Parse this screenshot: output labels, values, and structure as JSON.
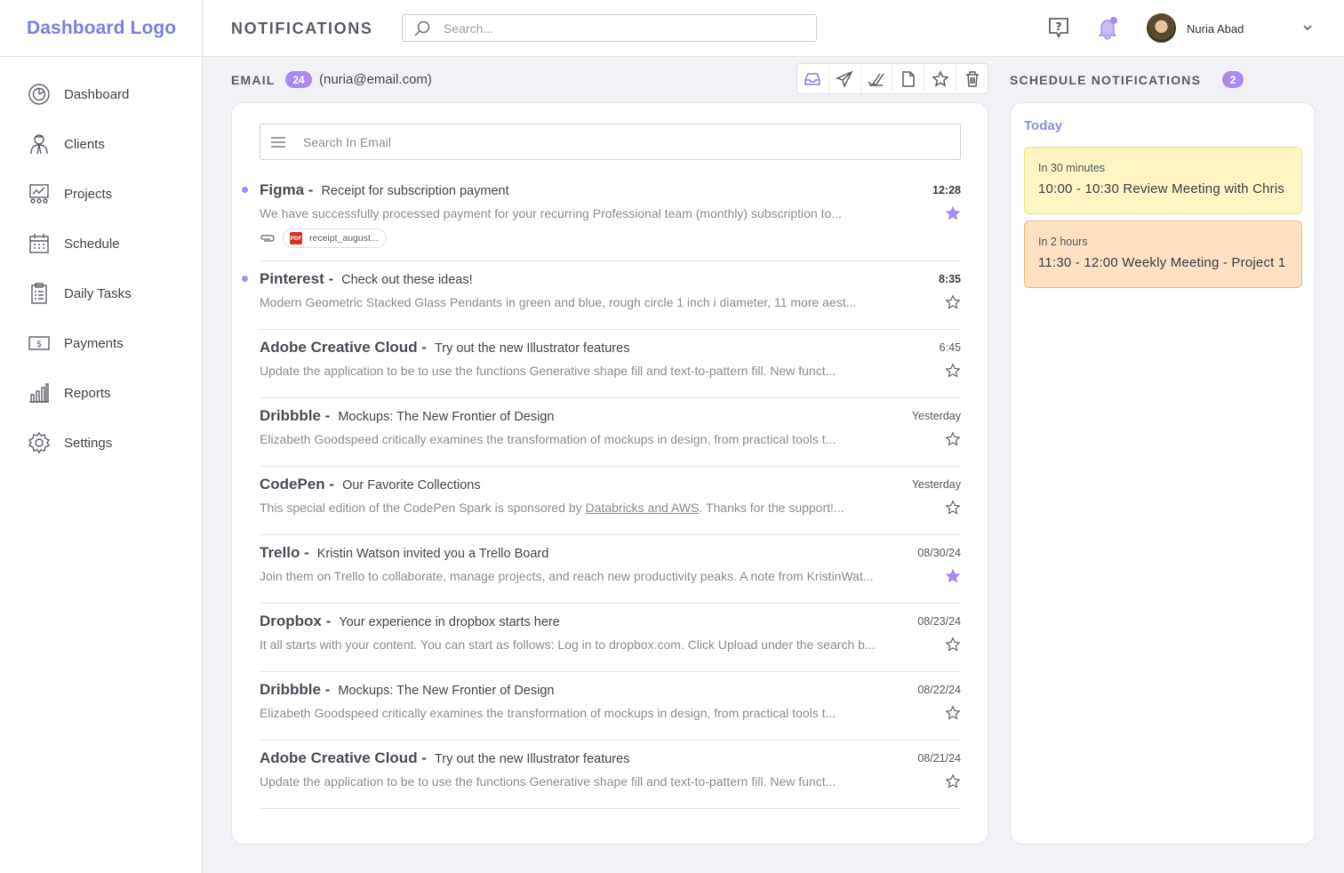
{
  "app": {
    "logo": "Dashboard Logo"
  },
  "sidebar": {
    "items": [
      {
        "label": "Dashboard",
        "icon": "dashboard-icon"
      },
      {
        "label": "Clients",
        "icon": "clients-icon"
      },
      {
        "label": "Projects",
        "icon": "projects-icon"
      },
      {
        "label": "Schedule",
        "icon": "calendar-icon"
      },
      {
        "label": "Daily Tasks",
        "icon": "clipboard-icon"
      },
      {
        "label": "Payments",
        "icon": "dollar-icon"
      },
      {
        "label": "Reports",
        "icon": "bar-chart-icon"
      },
      {
        "label": "Settings",
        "icon": "gear-icon"
      }
    ]
  },
  "header": {
    "title": "NOTIFICATIONS",
    "search_placeholder": "Search...",
    "user_name": "Nuria Abad"
  },
  "email": {
    "label": "EMAIL",
    "count": "24",
    "address": "(nuria@email.com)",
    "toolbar": [
      "inbox-icon",
      "send-icon",
      "read-icon",
      "document-icon",
      "star-icon",
      "trash-icon"
    ],
    "search_placeholder": "Search In Email",
    "messages": [
      {
        "sender": "Figma -",
        "subject": "Receipt for subscription payment",
        "preview": "We have successfully processed payment for your recurring Professional team (monthly) subscription to...",
        "time": "12:28",
        "unread": true,
        "starred": true,
        "attachment": "receipt_august..."
      },
      {
        "sender": "Pinterest -",
        "subject": "Check out these ideas!",
        "preview": "Modern Geometric Stacked Glass Pendants in green and blue, rough circle 1 inch i diameter, 11 more aest...",
        "time": "8:35",
        "unread": true,
        "starred": false
      },
      {
        "sender": "Adobe Creative Cloud -",
        "subject": "Try out the new Illustrator features",
        "preview": "Update the application to be to use the functions Generative shape fill and text-to-pattern fill. New funct...",
        "time": "6:45",
        "unread": false,
        "starred": false
      },
      {
        "sender": "Dribbble -",
        "subject": "Mockups: The New Frontier of Design",
        "preview": "Elizabeth Goodspeed critically examines the transformation of mockups in design, from practical tools t...",
        "time": "Yesterday",
        "unread": false,
        "starred": false
      },
      {
        "sender": "CodePen -",
        "subject": "Our Favorite Collections",
        "preview_before": "This special edition of the CodePen Spark is sponsored by ",
        "preview_link": "Databricks and AWS",
        "preview_after": ". Thanks for the support!...",
        "time": "Yesterday",
        "unread": false,
        "starred": false
      },
      {
        "sender": "Trello -",
        "subject": "Kristin Watson invited you a Trello Board",
        "preview": "Join them on Trello to collaborate, manage projects, and reach new productivity peaks. A note from KristinWat...",
        "time": "08/30/24",
        "unread": false,
        "starred": true
      },
      {
        "sender": "Dropbox -",
        "subject": "Your experience in dropbox starts here",
        "preview": "It all starts with your content. You can start as follows: Log in to dropbox.com. Click Upload under the search b...",
        "time": "08/23/24",
        "unread": false,
        "starred": false
      },
      {
        "sender": "Dribbble -",
        "subject": "Mockups: The New Frontier of Design",
        "preview": "Elizabeth Goodspeed critically examines the transformation of mockups in design, from practical tools t...",
        "time": "08/22/24",
        "unread": false,
        "starred": false
      },
      {
        "sender": "Adobe Creative Cloud -",
        "subject": "Try out the new Illustrator features",
        "preview": "Update the application to be to use the functions Generative shape fill and text-to-pattern fill. New funct...",
        "time": "08/21/24",
        "unread": false,
        "starred": false
      }
    ]
  },
  "schedule": {
    "label": "SCHEDULE NOTIFICATIONS",
    "count": "2",
    "today_label": "Today",
    "events": [
      {
        "when": "In 30 minutes",
        "title": "10:00 - 10:30 Review Meeting with Chris",
        "color": "#fdf6c4"
      },
      {
        "when": "In 2 hours",
        "title": "11:30 - 12:00 Weekly Meeting - Project 1",
        "color": "#fde1c2"
      }
    ]
  },
  "colors": {
    "accent": "#a98af0",
    "logo": "#7a7ee6",
    "star_filled": "#a98af0"
  }
}
